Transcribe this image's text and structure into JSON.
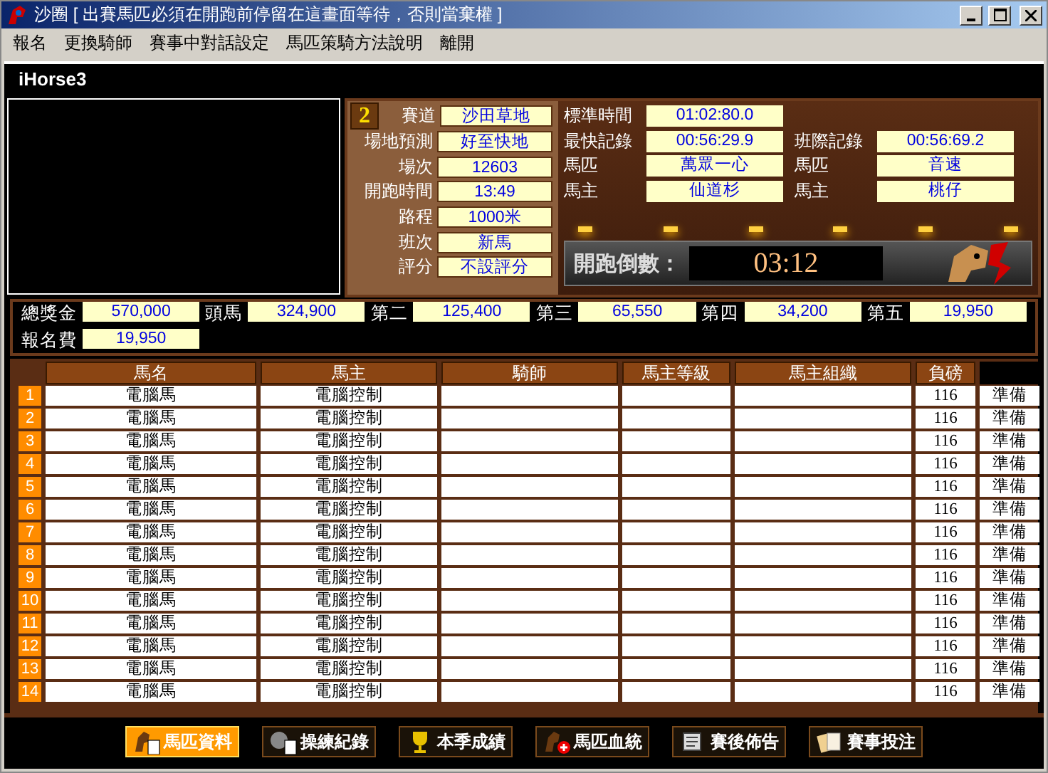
{
  "window": {
    "title": "沙圈 [ 出賽馬匹必須在開跑前停留在這畫面等待，否則當棄權 ]"
  },
  "menu": [
    "報名",
    "更換騎師",
    "賽事中對話設定",
    "馬匹策騎方法說明",
    "離開"
  ],
  "app_title": "iHorse3",
  "race": {
    "number": "2",
    "fields": [
      {
        "label": "賽道",
        "value": "沙田草地"
      },
      {
        "label": "場地預測",
        "value": "好至快地"
      },
      {
        "label": "場次",
        "value": "12603"
      },
      {
        "label": "開跑時間",
        "value": "13:49"
      },
      {
        "label": "路程",
        "value": "1000米"
      },
      {
        "label": "班次",
        "value": "新馬"
      },
      {
        "label": "評分",
        "value": "不設評分"
      }
    ]
  },
  "records": [
    [
      {
        "label": "標準時間",
        "value": "01:02:80.0"
      }
    ],
    [
      {
        "label": "最快記錄",
        "value": "00:56:29.9"
      },
      {
        "label": "班際記錄",
        "value": "00:56:69.2"
      }
    ],
    [
      {
        "label": "馬匹",
        "value": "萬眾一心"
      },
      {
        "label": "馬匹",
        "value": "音速"
      }
    ],
    [
      {
        "label": "馬主",
        "value": "仙道杉"
      },
      {
        "label": "馬主",
        "value": "桃仔"
      }
    ]
  ],
  "countdown": {
    "label": "開跑倒數：",
    "value": "03:12"
  },
  "prizes": [
    {
      "label": "總獎金",
      "value": "570,000"
    },
    {
      "label": "頭馬",
      "value": "324,900"
    },
    {
      "label": "第二",
      "value": "125,400"
    },
    {
      "label": "第三",
      "value": "65,550"
    },
    {
      "label": "第四",
      "value": "34,200"
    },
    {
      "label": "第五",
      "value": "19,950"
    },
    {
      "label": "報名費",
      "value": "19,950"
    }
  ],
  "table": {
    "columns": [
      "馬名",
      "馬主",
      "騎師",
      "馬主等級",
      "馬主組織",
      "負磅"
    ],
    "rows": [
      {
        "no": "1",
        "horse": "電腦馬",
        "owner": "電腦控制",
        "weight": "116",
        "status": "準備"
      },
      {
        "no": "2",
        "horse": "電腦馬",
        "owner": "電腦控制",
        "weight": "116",
        "status": "準備"
      },
      {
        "no": "3",
        "horse": "電腦馬",
        "owner": "電腦控制",
        "weight": "116",
        "status": "準備"
      },
      {
        "no": "4",
        "horse": "電腦馬",
        "owner": "電腦控制",
        "weight": "116",
        "status": "準備"
      },
      {
        "no": "5",
        "horse": "電腦馬",
        "owner": "電腦控制",
        "weight": "116",
        "status": "準備"
      },
      {
        "no": "6",
        "horse": "電腦馬",
        "owner": "電腦控制",
        "weight": "116",
        "status": "準備"
      },
      {
        "no": "7",
        "horse": "電腦馬",
        "owner": "電腦控制",
        "weight": "116",
        "status": "準備"
      },
      {
        "no": "8",
        "horse": "電腦馬",
        "owner": "電腦控制",
        "weight": "116",
        "status": "準備"
      },
      {
        "no": "9",
        "horse": "電腦馬",
        "owner": "電腦控制",
        "weight": "116",
        "status": "準備"
      },
      {
        "no": "10",
        "horse": "電腦馬",
        "owner": "電腦控制",
        "weight": "116",
        "status": "準備"
      },
      {
        "no": "11",
        "horse": "電腦馬",
        "owner": "電腦控制",
        "weight": "116",
        "status": "準備"
      },
      {
        "no": "12",
        "horse": "電腦馬",
        "owner": "電腦控制",
        "weight": "116",
        "status": "準備"
      },
      {
        "no": "13",
        "horse": "電腦馬",
        "owner": "電腦控制",
        "weight": "116",
        "status": "準備"
      },
      {
        "no": "14",
        "horse": "電腦馬",
        "owner": "電腦控制",
        "weight": "116",
        "status": "準備"
      }
    ]
  },
  "toolbar": [
    {
      "label": "馬匹資料",
      "kind": "horse-doc",
      "selected": true
    },
    {
      "label": "操練紀錄",
      "kind": "doc",
      "selected": false
    },
    {
      "label": "本季成績",
      "kind": "trophy",
      "selected": false
    },
    {
      "label": "馬匹血統",
      "kind": "horse-plus",
      "selected": false
    },
    {
      "label": "賽後佈告",
      "kind": "scroll",
      "selected": false
    },
    {
      "label": "賽事投注",
      "kind": "cards",
      "selected": false
    }
  ]
}
